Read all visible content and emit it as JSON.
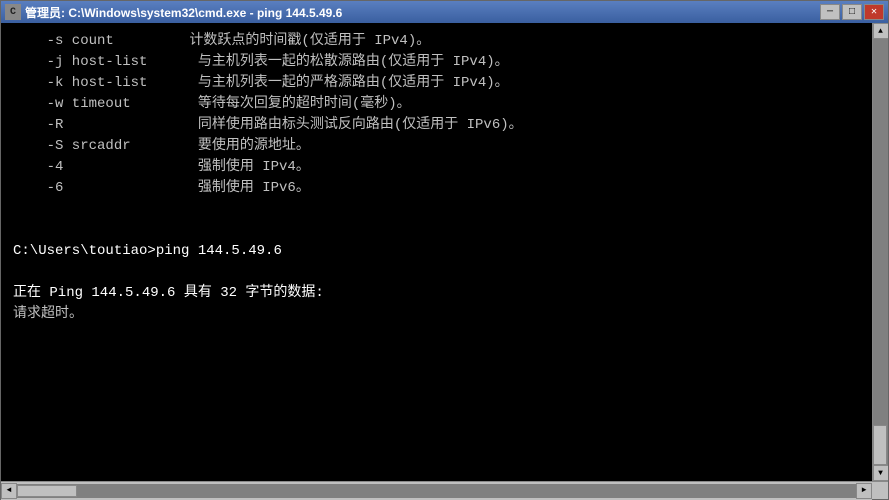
{
  "window": {
    "title": "管理员: C:\\Windows\\system32\\cmd.exe - ping 144.5.49.6",
    "icon": "■"
  },
  "titlebar": {
    "minimize_label": "─",
    "maximize_label": "□",
    "close_label": "✕"
  },
  "terminal": {
    "lines": [
      {
        "text": "    -s count         计数跃点的时间戳(仅适用于 IPv4)。",
        "type": "normal"
      },
      {
        "text": "    -j host-list      与主机列表一起的松散源路由(仅适用于 IPv4)。",
        "type": "normal"
      },
      {
        "text": "    -k host-list      与主机列表一起的严格源路由(仅适用于 IPv4)。",
        "type": "normal"
      },
      {
        "text": "    -w timeout        等待每次回复的超时时间(毫秒)。",
        "type": "normal"
      },
      {
        "text": "    -R                同样使用路由标头测试反向路由(仅适用于 IPv6)。",
        "type": "normal"
      },
      {
        "text": "    -S srcaddr        要使用的源地址。",
        "type": "normal"
      },
      {
        "text": "    -4                强制使用 IPv4。",
        "type": "normal"
      },
      {
        "text": "    -6                强制使用 IPv6。",
        "type": "normal"
      },
      {
        "text": "",
        "type": "empty"
      },
      {
        "text": "",
        "type": "empty"
      },
      {
        "text": "C:\\Users\\toutiao>ping 144.5.49.6",
        "type": "cmd"
      },
      {
        "text": "",
        "type": "empty"
      },
      {
        "text": "正在 Ping 144.5.49.6 具有 32 字节的数据:",
        "type": "ping-header"
      },
      {
        "text": "请求超时。",
        "type": "timeout"
      }
    ]
  },
  "scrollbar": {
    "up_arrow": "▲",
    "down_arrow": "▼",
    "left_arrow": "◄",
    "right_arrow": "►"
  }
}
